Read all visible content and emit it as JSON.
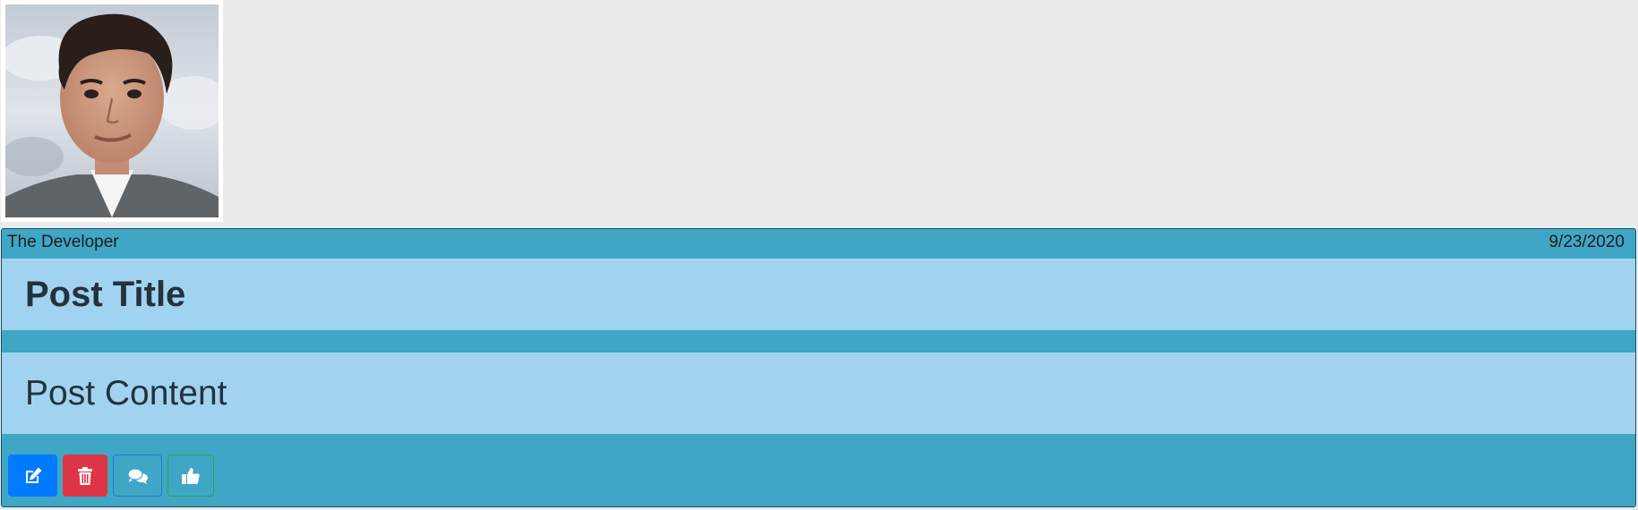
{
  "avatar": {
    "alt": "profile photo"
  },
  "post": {
    "author": "The Developer",
    "date": "9/23/2020",
    "title": "Post Title",
    "content": "Post Content",
    "actions": [
      {
        "name": "edit",
        "icon": "edit-icon"
      },
      {
        "name": "delete",
        "icon": "trash-icon"
      },
      {
        "name": "comments",
        "icon": "comments-icon"
      },
      {
        "name": "like",
        "icon": "thumbs-up-icon"
      }
    ]
  },
  "colors": {
    "page_bg": "#e9ecef",
    "card_bg": "#40a6c6",
    "band_bg": "#a1d3f1",
    "edit": "#007bff",
    "delete": "#dc3545",
    "like_border": "#28a745"
  }
}
